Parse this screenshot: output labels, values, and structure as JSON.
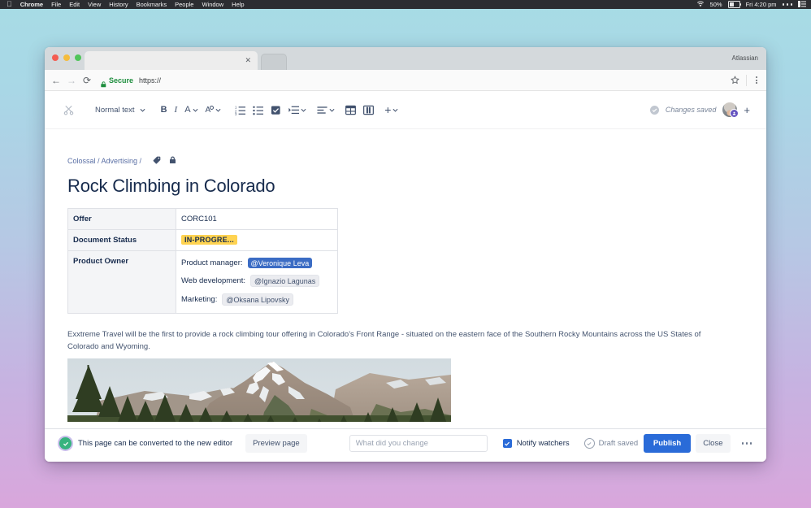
{
  "menubar": {
    "apple_icon": "apple-icon",
    "items": [
      "Chrome",
      "File",
      "Edit",
      "View",
      "History",
      "Bookmarks",
      "People",
      "Window",
      "Help"
    ],
    "status": {
      "wifi_icon": "wifi-icon",
      "battery_percent": "50%",
      "battery_icon": "battery-icon",
      "clock": "Fri 4:20 pm",
      "more_icon": "ellipsis-icon",
      "control_center_icon": "control-center-icon"
    }
  },
  "browser": {
    "tab_title": "",
    "tab_close_icon": "close-icon",
    "window_label": "Atlassian",
    "back_icon": "back-arrow-icon",
    "forward_icon": "forward-arrow-icon",
    "reload_icon": "reload-icon",
    "lock_icon": "lock-icon",
    "secure_label": "Secure",
    "url": "https://",
    "bookmark_icon": "star-icon",
    "menu_icon": "kebab-menu-icon"
  },
  "editor_toolbar": {
    "cut_icon": "scissors-icon",
    "text_style": "Normal text",
    "bold_label": "B",
    "italic_label": "I",
    "text_color_label": "A",
    "more_formatting_label": "A",
    "numbered_list_icon": "numbered-list-icon",
    "bullet_list_icon": "bullet-list-icon",
    "task_list_icon": "task-list-icon",
    "indent_icon": "indent-icon",
    "align_icon": "text-align-icon",
    "table_icon": "table-icon",
    "layout_icon": "page-layout-icon",
    "insert_label": "+",
    "saved_status": "Changes saved",
    "saved_icon": "check-circle-icon",
    "avatar_name": "user-avatar",
    "add_user_label": "+"
  },
  "page": {
    "breadcrumb": "Colossal / Advertising /",
    "label_icon": "tag-icon",
    "restrictions_icon": "lock-icon",
    "title": "Rock Climbing in Colorado",
    "table": {
      "rows": [
        {
          "header": "Offer",
          "value": "CORC101"
        },
        {
          "header": "Document Status",
          "value": "IN-PROGRE..."
        },
        {
          "header": "Product Owner",
          "value": ""
        }
      ],
      "owner": [
        {
          "label": "Product manager:",
          "mention": "@Veronique Leva",
          "style": "selected"
        },
        {
          "label": "Web development:",
          "mention": "@Ignazio Lagunas",
          "style": "plain"
        },
        {
          "label": "Marketing:",
          "mention": "@Oksana Lipovsky",
          "style": "plain"
        }
      ]
    },
    "paragraph": "Exxtreme Travel will be the first to provide a rock climbing tour offering in Colorado's Front Range - situated on the eastern face of the Southern Rocky Mountains across the US States of Colorado and Wyoming.",
    "image_alt": "snow-capped mountain range with pine forest"
  },
  "bottom_bar": {
    "convert_icon": "success-check-icon",
    "convert_message": "This page can be converted to the new editor",
    "preview_label": "Preview page",
    "change_input_value": "",
    "change_input_placeholder": "What did you change",
    "notify_checkbox_icon": "checked-checkbox-icon",
    "notify_label": "Notify watchers",
    "draft_icon": "check-circle-outline-icon",
    "draft_label": "Draft saved",
    "publish_label": "Publish",
    "close_label": "Close",
    "more_icon": "ellipsis-icon"
  },
  "colors": {
    "accent": "#2a6bd8",
    "status_yellow": "#ffd351",
    "mention_blue": "#3b6cc4",
    "success_green": "#36b37e",
    "text_dark": "#172b4d"
  }
}
